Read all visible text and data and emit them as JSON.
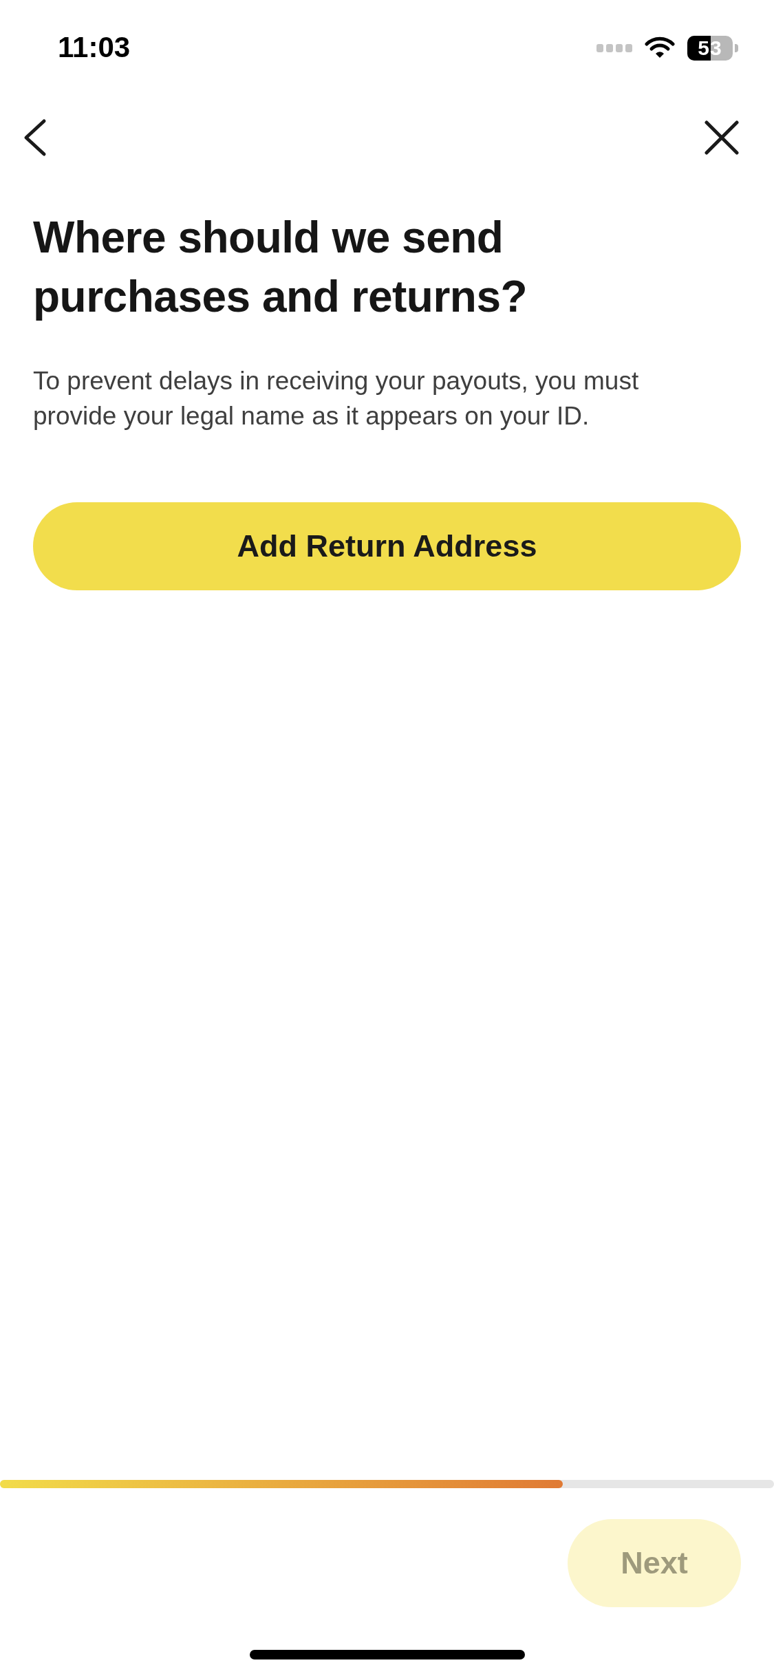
{
  "status_bar": {
    "time": "11:03",
    "battery": "53"
  },
  "title": "Where should we send purchases and returns?",
  "description": "To prevent delays in receiving your payouts, you must provide your legal name as it appears on your ID.",
  "primary_button": {
    "label": "Add Return Address"
  },
  "progress": {
    "level": 0.727
  },
  "next_button": {
    "label": "Next",
    "disabled": true
  }
}
